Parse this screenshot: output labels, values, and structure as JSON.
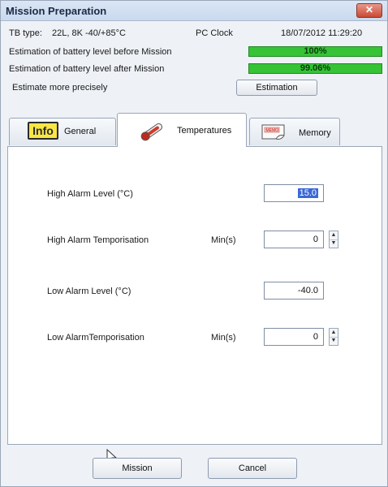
{
  "window": {
    "title": "Mission Preparation",
    "close_label": "✕"
  },
  "info": {
    "tb_type_label": "TB type:",
    "tb_type_value": "22L, 8K -40/+85°C",
    "pc_clock_label": "PC Clock",
    "pc_clock_value": "18/07/2012 11:29:20",
    "battery_before_label": "Estimation of battery level before Mission",
    "battery_before_value": "100%",
    "battery_before_level": 1.0,
    "battery_after_label": "Estimation of battery level after Mission",
    "battery_after_value": "99.06%",
    "battery_after_level": 0.9906,
    "estimate_label": "Estimate more precisely",
    "estimation_button": "Estimation"
  },
  "tabs": [
    {
      "label": "General",
      "icon": "info-icon",
      "icon_text": "Info"
    },
    {
      "label": "Temperatures",
      "icon": "thermometer-icon",
      "active": true
    },
    {
      "label": "Memory",
      "icon": "memory-icon",
      "icon_text": "MEMO"
    }
  ],
  "form": {
    "high_alarm_level_label": "High Alarm Level (°C)",
    "high_alarm_level_value": "15.0",
    "high_alarm_temp_label": "High Alarm Temporisation",
    "high_alarm_temp_unit": "Min(s)",
    "high_alarm_temp_value": "0",
    "low_alarm_level_label": "Low Alarm Level (°C)",
    "low_alarm_level_value": "-40.0",
    "low_alarm_temp_label": "Low AlarmTemporisation",
    "low_alarm_temp_unit": "Min(s)",
    "low_alarm_temp_value": "0"
  },
  "footer": {
    "mission_button": "Mission",
    "cancel_button": "Cancel"
  }
}
